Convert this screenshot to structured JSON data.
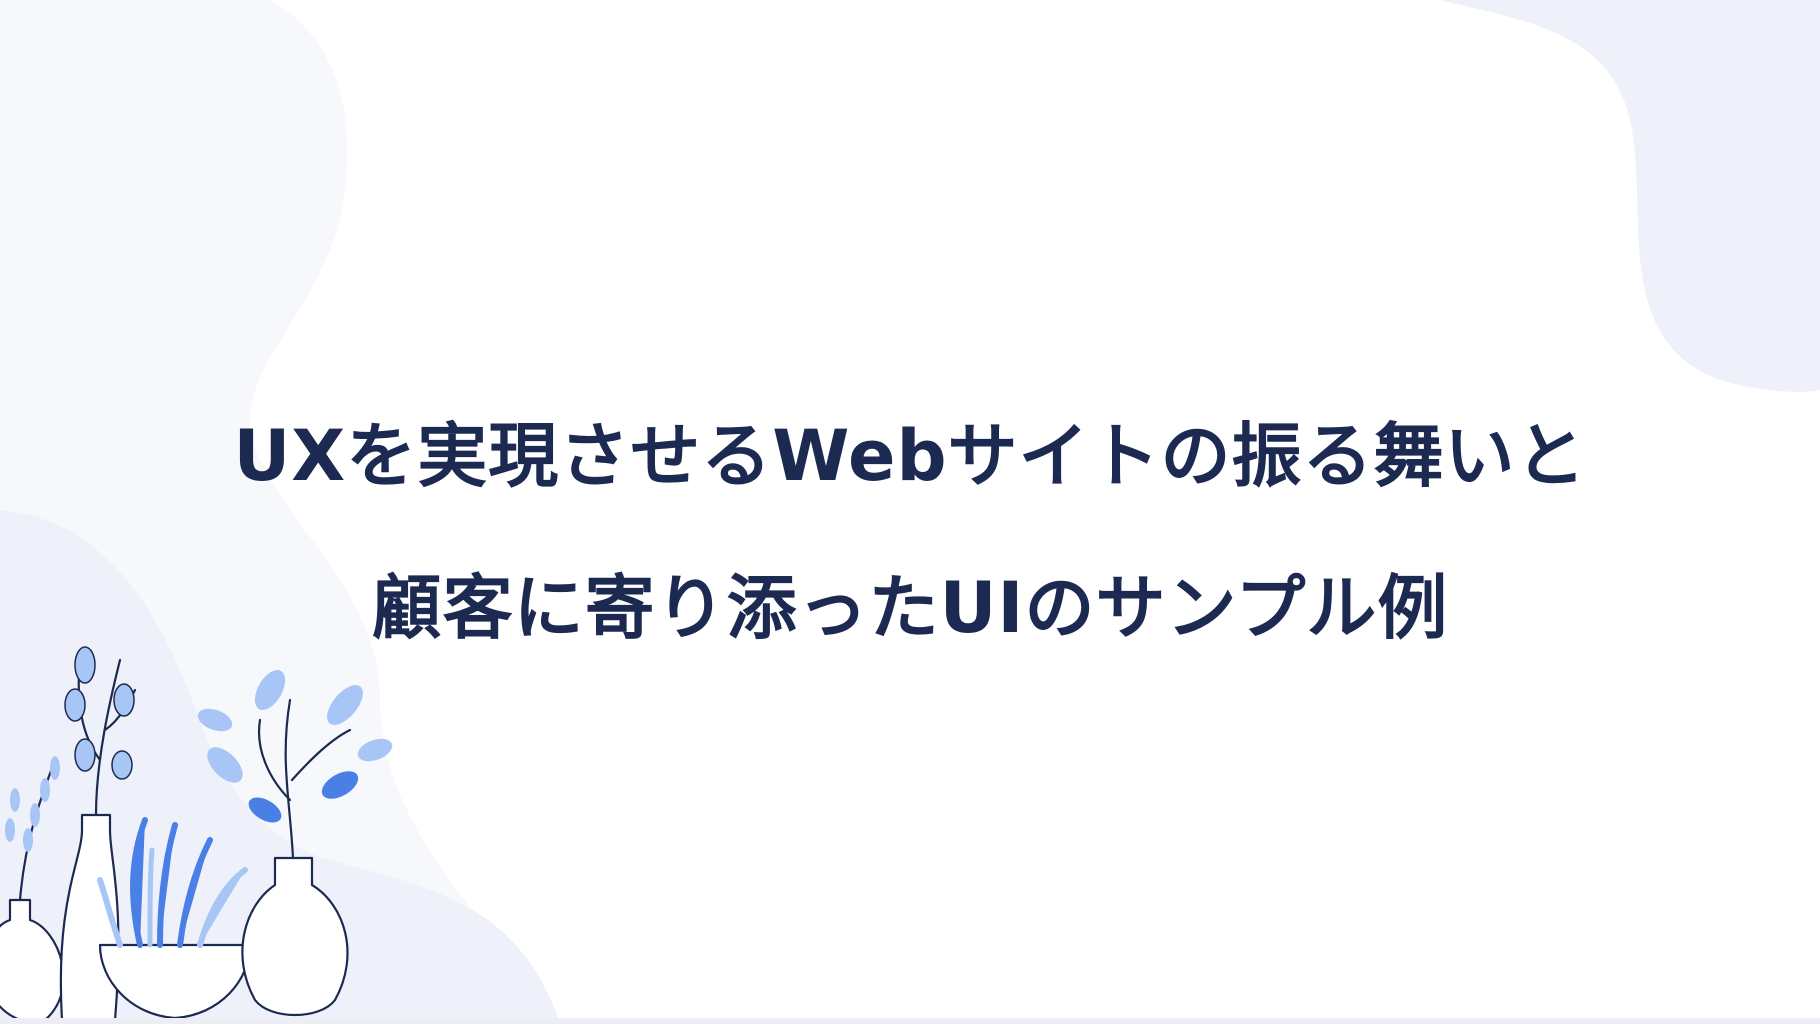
{
  "slide": {
    "title_line_1": "UXを実現させるWebサイトの振る舞いと",
    "title_line_2": "顧客に寄り添ったUIのサンプル例"
  },
  "colors": {
    "title_text": "#1c2a52",
    "blob_fill": "#eef1f9",
    "leaf_blue": "#4a7fe6",
    "leaf_light": "#a8c6f5",
    "line_dark": "#1c2a52"
  },
  "decorations": {
    "illustration": "potted-plants-illustration"
  }
}
